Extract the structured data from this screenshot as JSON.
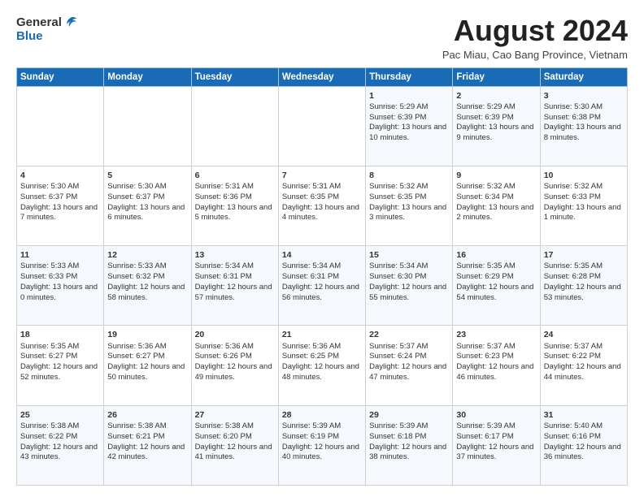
{
  "header": {
    "logo_general": "General",
    "logo_blue": "Blue",
    "month_title": "August 2024",
    "location": "Pac Miau, Cao Bang Province, Vietnam"
  },
  "weekdays": [
    "Sunday",
    "Monday",
    "Tuesday",
    "Wednesday",
    "Thursday",
    "Friday",
    "Saturday"
  ],
  "weeks": [
    [
      {
        "day": "",
        "text": ""
      },
      {
        "day": "",
        "text": ""
      },
      {
        "day": "",
        "text": ""
      },
      {
        "day": "",
        "text": ""
      },
      {
        "day": "1",
        "text": "Sunrise: 5:29 AM\nSunset: 6:39 PM\nDaylight: 13 hours and 10 minutes."
      },
      {
        "day": "2",
        "text": "Sunrise: 5:29 AM\nSunset: 6:39 PM\nDaylight: 13 hours and 9 minutes."
      },
      {
        "day": "3",
        "text": "Sunrise: 5:30 AM\nSunset: 6:38 PM\nDaylight: 13 hours and 8 minutes."
      }
    ],
    [
      {
        "day": "4",
        "text": "Sunrise: 5:30 AM\nSunset: 6:37 PM\nDaylight: 13 hours and 7 minutes."
      },
      {
        "day": "5",
        "text": "Sunrise: 5:30 AM\nSunset: 6:37 PM\nDaylight: 13 hours and 6 minutes."
      },
      {
        "day": "6",
        "text": "Sunrise: 5:31 AM\nSunset: 6:36 PM\nDaylight: 13 hours and 5 minutes."
      },
      {
        "day": "7",
        "text": "Sunrise: 5:31 AM\nSunset: 6:35 PM\nDaylight: 13 hours and 4 minutes."
      },
      {
        "day": "8",
        "text": "Sunrise: 5:32 AM\nSunset: 6:35 PM\nDaylight: 13 hours and 3 minutes."
      },
      {
        "day": "9",
        "text": "Sunrise: 5:32 AM\nSunset: 6:34 PM\nDaylight: 13 hours and 2 minutes."
      },
      {
        "day": "10",
        "text": "Sunrise: 5:32 AM\nSunset: 6:33 PM\nDaylight: 13 hours and 1 minute."
      }
    ],
    [
      {
        "day": "11",
        "text": "Sunrise: 5:33 AM\nSunset: 6:33 PM\nDaylight: 13 hours and 0 minutes."
      },
      {
        "day": "12",
        "text": "Sunrise: 5:33 AM\nSunset: 6:32 PM\nDaylight: 12 hours and 58 minutes."
      },
      {
        "day": "13",
        "text": "Sunrise: 5:34 AM\nSunset: 6:31 PM\nDaylight: 12 hours and 57 minutes."
      },
      {
        "day": "14",
        "text": "Sunrise: 5:34 AM\nSunset: 6:31 PM\nDaylight: 12 hours and 56 minutes."
      },
      {
        "day": "15",
        "text": "Sunrise: 5:34 AM\nSunset: 6:30 PM\nDaylight: 12 hours and 55 minutes."
      },
      {
        "day": "16",
        "text": "Sunrise: 5:35 AM\nSunset: 6:29 PM\nDaylight: 12 hours and 54 minutes."
      },
      {
        "day": "17",
        "text": "Sunrise: 5:35 AM\nSunset: 6:28 PM\nDaylight: 12 hours and 53 minutes."
      }
    ],
    [
      {
        "day": "18",
        "text": "Sunrise: 5:35 AM\nSunset: 6:27 PM\nDaylight: 12 hours and 52 minutes."
      },
      {
        "day": "19",
        "text": "Sunrise: 5:36 AM\nSunset: 6:27 PM\nDaylight: 12 hours and 50 minutes."
      },
      {
        "day": "20",
        "text": "Sunrise: 5:36 AM\nSunset: 6:26 PM\nDaylight: 12 hours and 49 minutes."
      },
      {
        "day": "21",
        "text": "Sunrise: 5:36 AM\nSunset: 6:25 PM\nDaylight: 12 hours and 48 minutes."
      },
      {
        "day": "22",
        "text": "Sunrise: 5:37 AM\nSunset: 6:24 PM\nDaylight: 12 hours and 47 minutes."
      },
      {
        "day": "23",
        "text": "Sunrise: 5:37 AM\nSunset: 6:23 PM\nDaylight: 12 hours and 46 minutes."
      },
      {
        "day": "24",
        "text": "Sunrise: 5:37 AM\nSunset: 6:22 PM\nDaylight: 12 hours and 44 minutes."
      }
    ],
    [
      {
        "day": "25",
        "text": "Sunrise: 5:38 AM\nSunset: 6:22 PM\nDaylight: 12 hours and 43 minutes."
      },
      {
        "day": "26",
        "text": "Sunrise: 5:38 AM\nSunset: 6:21 PM\nDaylight: 12 hours and 42 minutes."
      },
      {
        "day": "27",
        "text": "Sunrise: 5:38 AM\nSunset: 6:20 PM\nDaylight: 12 hours and 41 minutes."
      },
      {
        "day": "28",
        "text": "Sunrise: 5:39 AM\nSunset: 6:19 PM\nDaylight: 12 hours and 40 minutes."
      },
      {
        "day": "29",
        "text": "Sunrise: 5:39 AM\nSunset: 6:18 PM\nDaylight: 12 hours and 38 minutes."
      },
      {
        "day": "30",
        "text": "Sunrise: 5:39 AM\nSunset: 6:17 PM\nDaylight: 12 hours and 37 minutes."
      },
      {
        "day": "31",
        "text": "Sunrise: 5:40 AM\nSunset: 6:16 PM\nDaylight: 12 hours and 36 minutes."
      }
    ]
  ]
}
